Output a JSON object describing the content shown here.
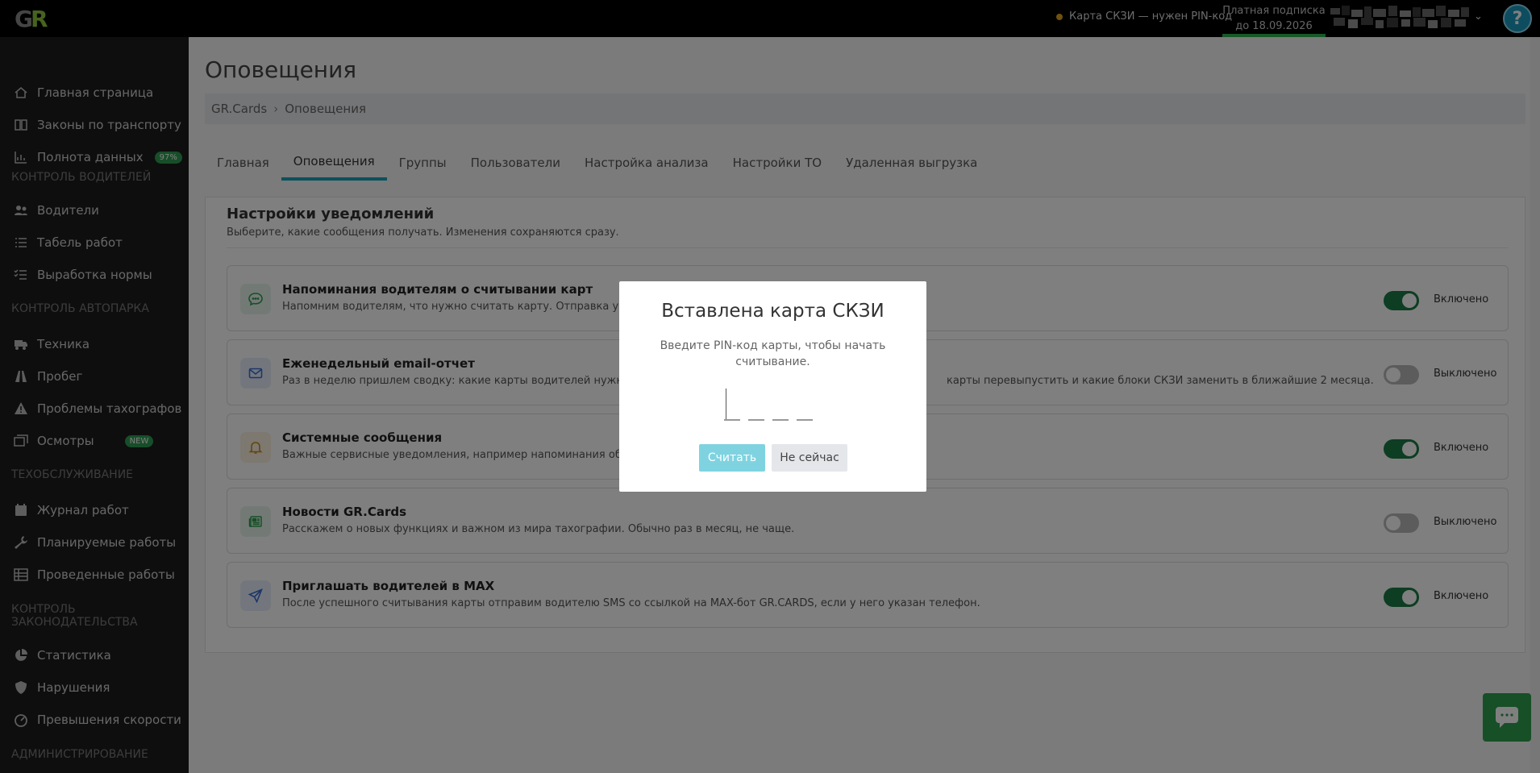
{
  "topbar": {
    "logo_text": "GR",
    "card_status": "Карта СКЗИ — нужен PIN-код",
    "subscription_line1": "Платная подписка",
    "subscription_line2": "до 18.09.2026",
    "help_label": "?"
  },
  "sidebar": {
    "items": [
      {
        "label": "Главная страница",
        "icon": "home-icon"
      },
      {
        "label": "Законы по транспорту",
        "icon": "book-icon"
      },
      {
        "label": "Полнота данных",
        "icon": "chart-icon",
        "badge": "97%"
      },
      {
        "label": "Водители",
        "icon": "users-icon"
      },
      {
        "label": "Табель работ",
        "icon": "list-icon"
      },
      {
        "label": "Выработка нормы",
        "icon": "checklist-icon"
      },
      {
        "label": "Техника",
        "icon": "truck-icon"
      },
      {
        "label": "Пробег",
        "icon": "road-icon"
      },
      {
        "label": "Проблемы тахографов",
        "icon": "warning-icon"
      },
      {
        "label": "Осмотры",
        "icon": "images-icon",
        "badge": "NEW"
      },
      {
        "label": "Журнал работ",
        "icon": "calendar-icon"
      },
      {
        "label": "Планируемые работы",
        "icon": "wrench-icon"
      },
      {
        "label": "Проведенные работы",
        "icon": "table-icon"
      },
      {
        "label": "Статистика",
        "icon": "pie-icon"
      },
      {
        "label": "Нарушения",
        "icon": "shield-icon"
      },
      {
        "label": "Превышения скорости",
        "icon": "gauge-icon"
      }
    ],
    "sections": [
      "КОНТРОЛЬ ВОДИТЕЛЕЙ",
      "КОНТРОЛЬ АВТОПАРКА",
      "ТЕХОБСЛУЖИВАНИЕ",
      "КОНТРОЛЬ ЗАКОНОДАТЕЛЬСТВА",
      "АДМИНИСТРИРОВАНИЕ"
    ]
  },
  "main": {
    "title": "Оповещения",
    "breadcrumb": [
      "GR.Cards",
      "Оповещения"
    ],
    "tabs": [
      "Главная",
      "Оповещения",
      "Группы",
      "Пользователи",
      "Настройка анализа",
      "Настройки ТО",
      "Удаленная выгрузка"
    ],
    "active_tab": 1,
    "panel_title": "Настройки уведомлений",
    "panel_subtitle": "Выберите, какие сообщения получать. Изменения сохраняются сразу.",
    "notifications": [
      {
        "title": "Напоминания водителям о считывании карт",
        "desc": "Напомним водителям, что нужно считать карту. Отправка уведом",
        "enabled": true,
        "state_label": "Включено",
        "icon": "chat-icon",
        "icon_bg": "#e6f4ec",
        "icon_color": "#2e9e4f"
      },
      {
        "title": "Еженедельный email-отчет",
        "desc": "Раз в неделю пришлем сводку: какие карты водителей нужно счи",
        "desc_tail": "карты перевыпустить и какие блоки СКЗИ заменить в ближайшие 2 месяца.",
        "enabled": false,
        "state_label": "Выключено",
        "icon": "mail-icon",
        "icon_bg": "#e7eefb",
        "icon_color": "#3b6fd1"
      },
      {
        "title": "Системные сообщения",
        "desc": "Важные сервисные уведомления, например напоминания об око",
        "enabled": true,
        "state_label": "Включено",
        "icon": "bell-icon",
        "icon_bg": "#fbf1e1",
        "icon_color": "#c98a1c"
      },
      {
        "title": "Новости GR.Cards",
        "desc": "Расскажем о новых функциях и важном из мира тахографии. Обычно раз в месяц, не чаще.",
        "enabled": false,
        "state_label": "Выключено",
        "icon": "newspaper-icon",
        "icon_bg": "#e6f4ec",
        "icon_color": "#2e9e4f"
      },
      {
        "title": "Приглашать водителей в MAX",
        "desc": "После успешного считывания карты отправим водителю SMS со ссылкой на MAX-бот GR.CARDS, если у него указан телефон.",
        "enabled": true,
        "state_label": "Включено",
        "icon": "send-icon",
        "icon_bg": "#e7eefb",
        "icon_color": "#3b6fd1"
      }
    ]
  },
  "modal": {
    "title": "Вставлена карта СКЗИ",
    "description": "Введите PIN-код карты, чтобы начать считывание.",
    "pin_length": 4,
    "read_button": "Считать",
    "later_button": "Не сейчас"
  },
  "colors": {
    "accent": "#17a2b8",
    "toggle_on": "#1b7a44",
    "toggle_off": "#b9b9b9",
    "sidebar_bg": "#1d1d1d",
    "brand_green": "#2e9e4f"
  }
}
